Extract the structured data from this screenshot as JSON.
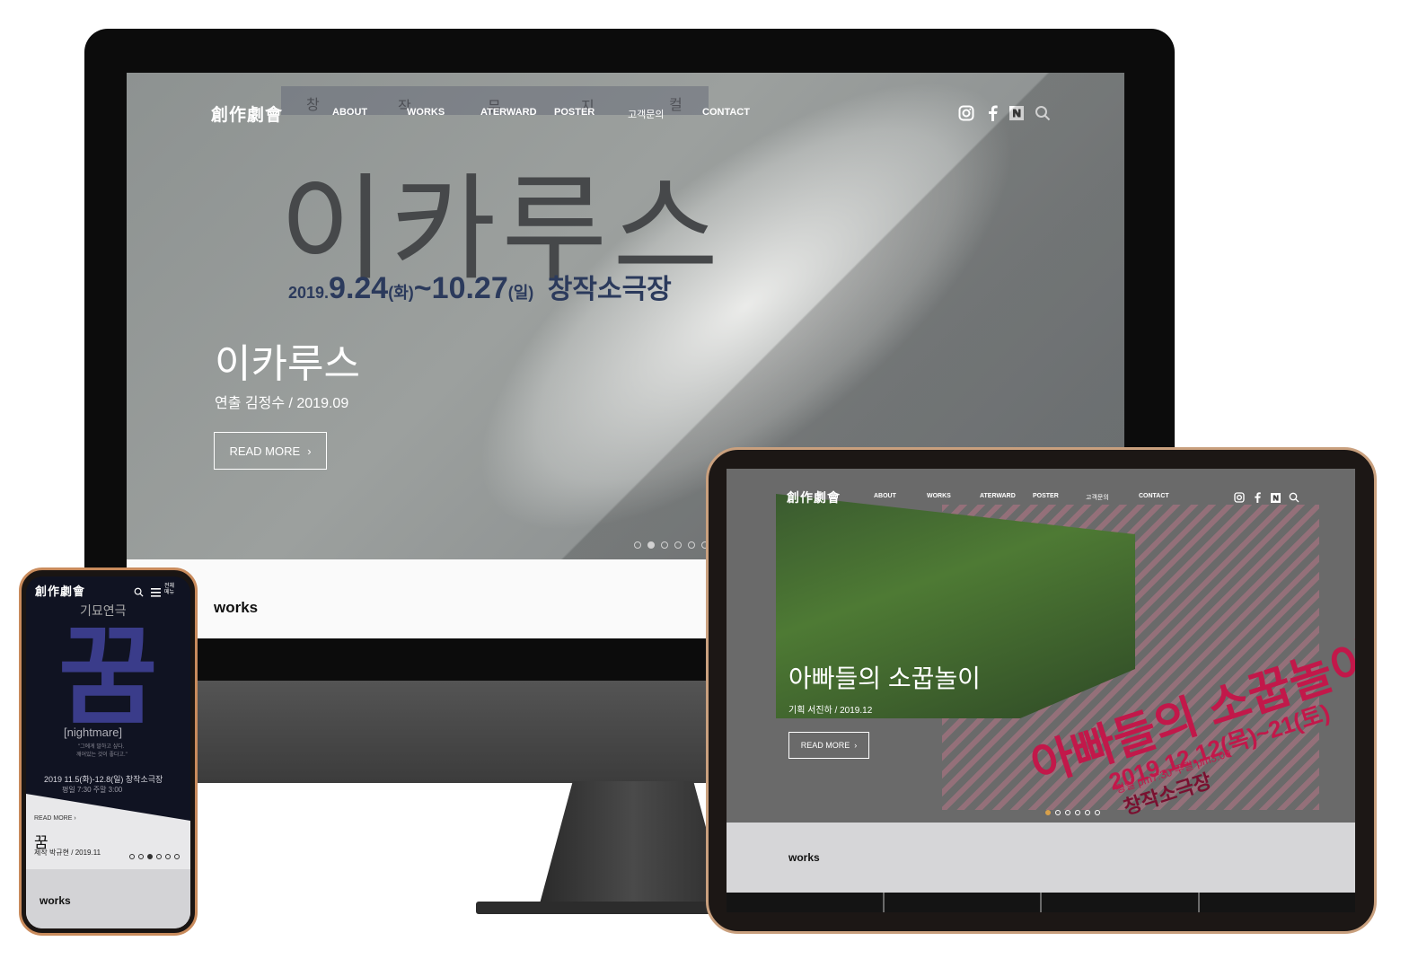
{
  "desktop": {
    "logo": "創作劇會",
    "nav": {
      "deco": [
        "창",
        "작",
        "뮤",
        "지",
        "컬"
      ],
      "items": [
        "ABOUT",
        "WORKS",
        "ATERWARD",
        "POSTER",
        "고객문의",
        "CONTACT"
      ]
    },
    "poster": {
      "title": "이카루스",
      "date_prefix": "2019.",
      "date_start": "9.24",
      "day_start": "(화)",
      "tilde": "~",
      "date_end": "10.27",
      "day_end": "(일)",
      "venue": "창작소극장"
    },
    "slide": {
      "title": "이카루스",
      "subtitle": "연출 김정수 / 2019.09",
      "button": "READ MORE"
    },
    "section_title": "works"
  },
  "tablet": {
    "logo": "創作劇會",
    "nav": [
      "ABOUT",
      "WORKS",
      "ATERWARD",
      "POSTER",
      "고객문의",
      "CONTACT"
    ],
    "poster": {
      "title": "아빠들의 소꿉놀이",
      "date": "2019.12.12(목)~21(토)",
      "time": "평일 pm7:30 주말 pm3:00",
      "venue": "창작소극장"
    },
    "slide": {
      "title": "아빠들의 소꿉놀이",
      "subtitle": "기획 서진하 / 2019.12",
      "button": "READ MORE"
    },
    "section_title": "works"
  },
  "phone": {
    "logo": "創作劇會",
    "menu_label": "전체메뉴",
    "poster": {
      "kicker": "기묘연극",
      "glyph": "꿈",
      "subtitle": "[nightmare]",
      "quote1": "\"그에게 말하고 싶다.",
      "quote2": "깨어있는 것이 좋다고.\"",
      "dates": "2019 11.5(화)-12.8(일) 창작소극장",
      "times": "평일 7:30 주말 3:00"
    },
    "slide": {
      "read_more": "READ MORE",
      "title": "꿈",
      "subtitle": "제작 박규현 / 2019.11"
    },
    "section_title": "works"
  },
  "colors": {
    "poster_navy": "#2b3a5c",
    "poster_magenta": "#c2184a",
    "tablet_bezel_accent": "#c9a07e",
    "phone_bezel_accent": "#c98b5c"
  }
}
